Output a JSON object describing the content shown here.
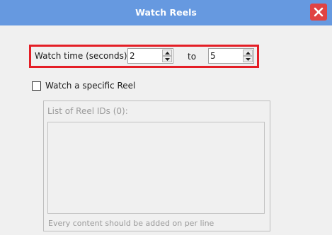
{
  "window": {
    "title": "Watch Reels",
    "close_icon": "close-icon",
    "titlebar_color": "#6699e0",
    "close_color": "#e04343"
  },
  "watch_time": {
    "label": "Watch time (seconds):",
    "min_value": "2",
    "separator": "to",
    "max_value": "5",
    "highlight_color": "#e41e26"
  },
  "specific_reel": {
    "label": "Watch a specific Reel",
    "checked": false
  },
  "reel_list": {
    "title": "List of Reel IDs (0):",
    "items": [],
    "hint": "Every content should be added on per line"
  }
}
